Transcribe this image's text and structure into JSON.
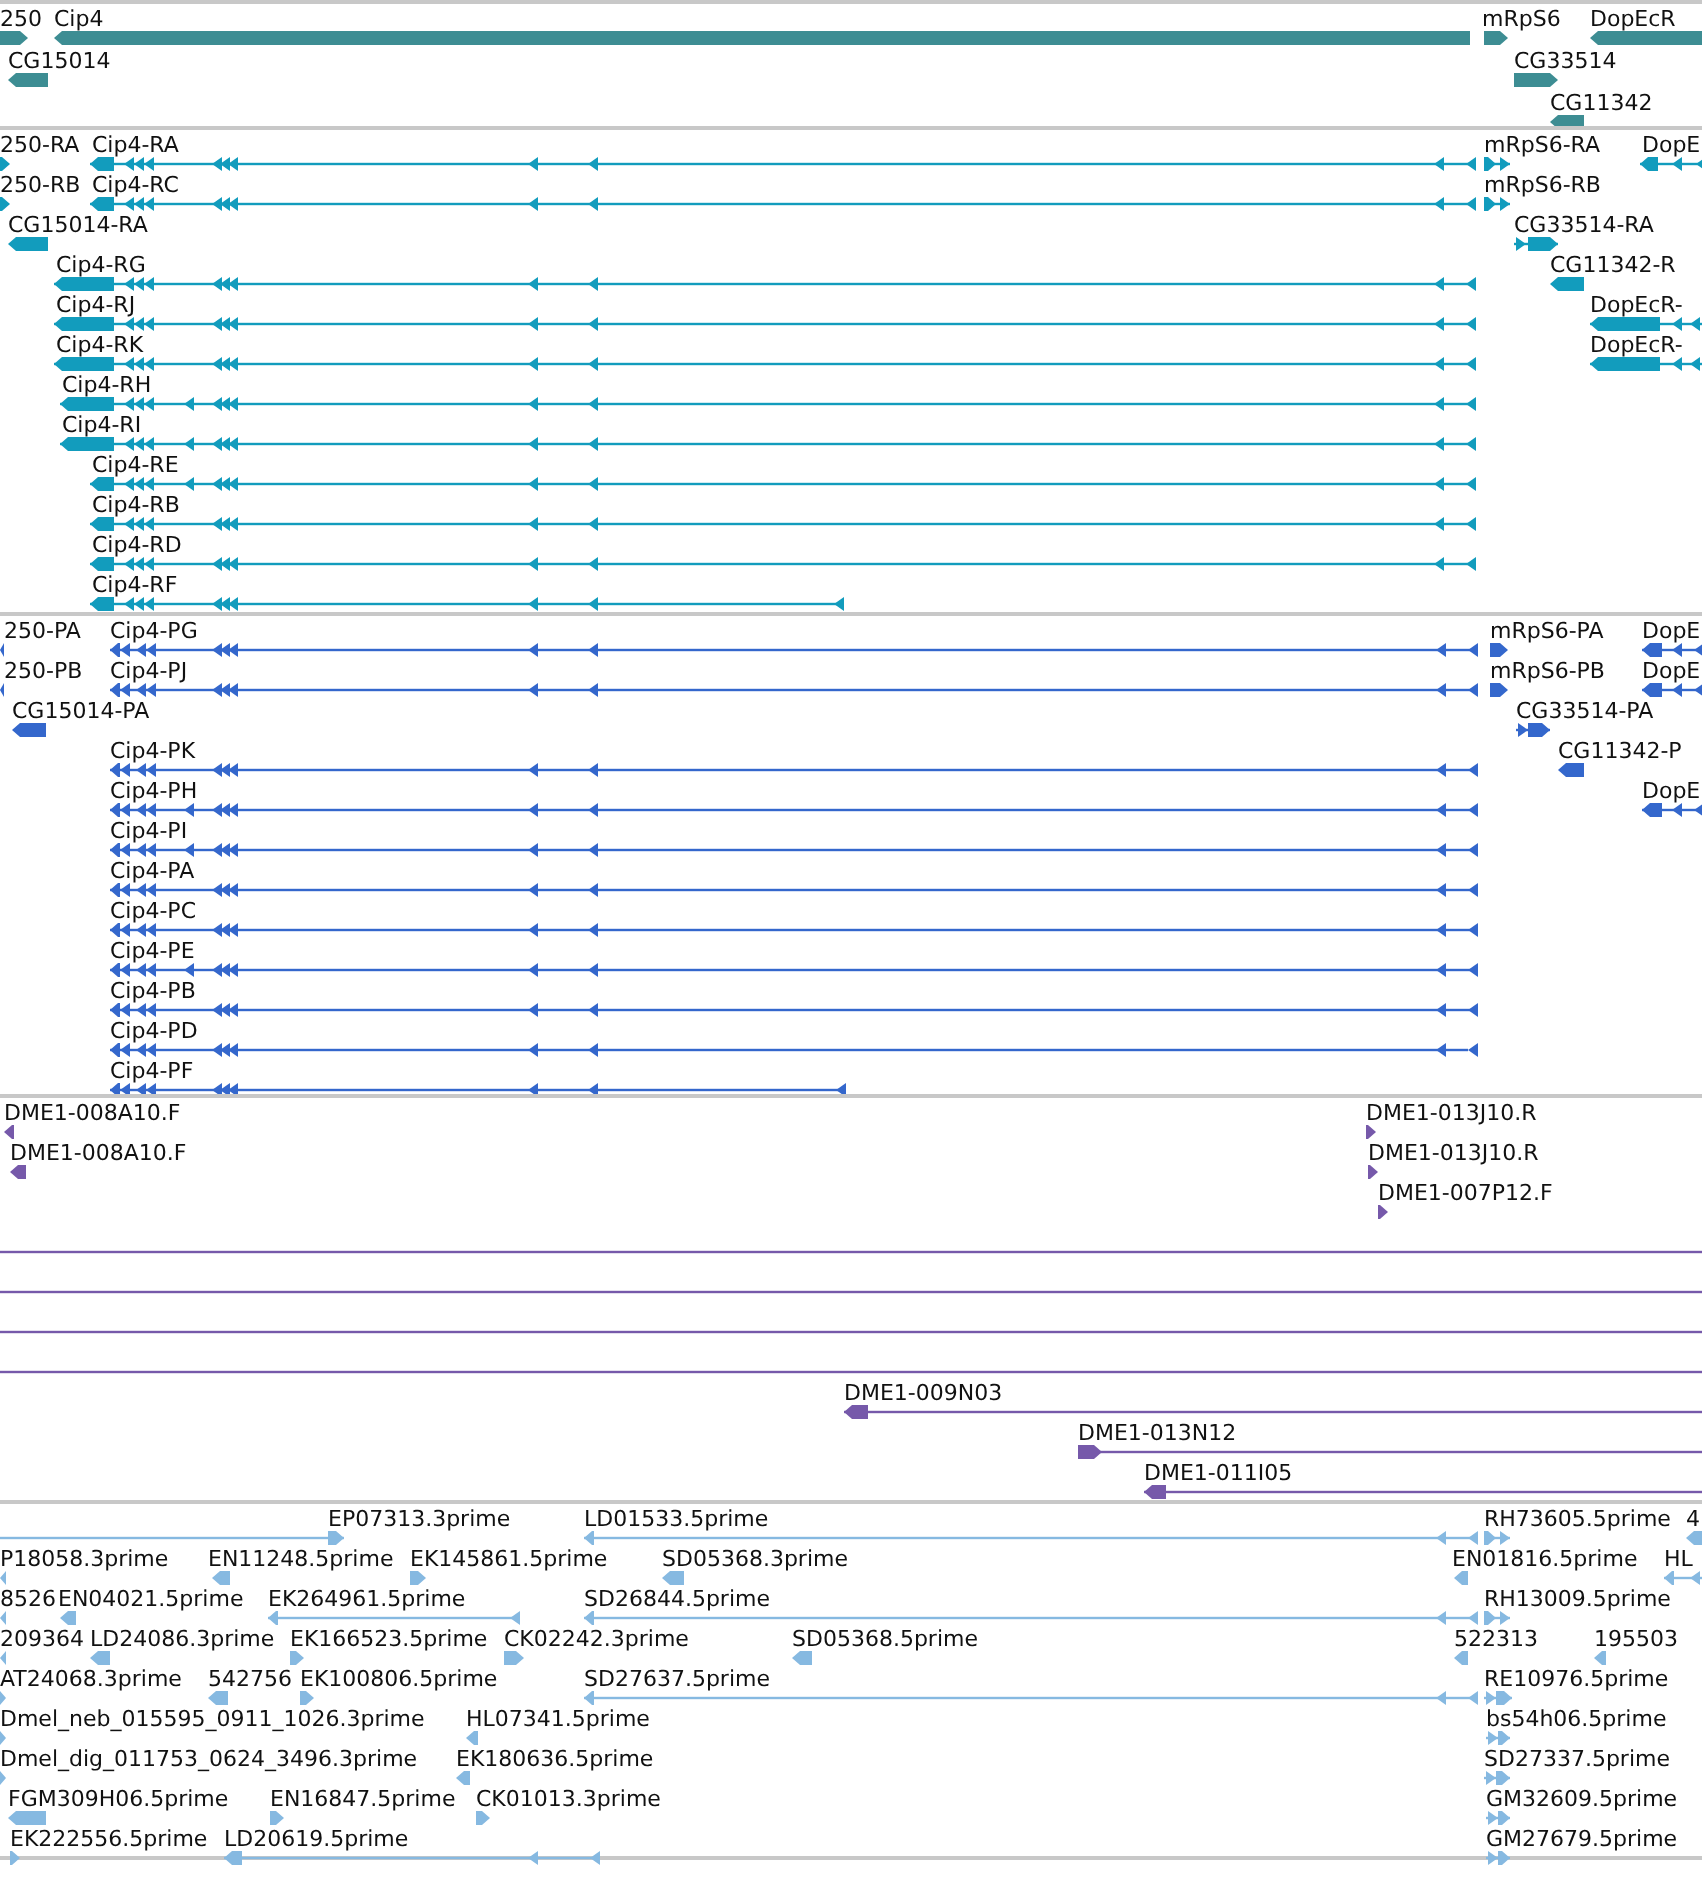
{
  "tracks": [
    {
      "kind": "gene",
      "features": [
        {
          "label": "250",
          "reverse": false
        },
        {
          "label": "Cip4",
          "reverse": true
        },
        {
          "label": "mRpS6",
          "reverse": false
        },
        {
          "label": "DopEcR",
          "reverse": true
        },
        {
          "label": "CG15014",
          "reverse": true
        },
        {
          "label": "CG33514",
          "reverse": false
        },
        {
          "label": "CG11342",
          "reverse": true
        }
      ]
    },
    {
      "kind": "mrna",
      "features": [
        {
          "label": "250-RA",
          "reverse": false
        },
        {
          "label": "Cip4-RA",
          "reverse": true
        },
        {
          "label": "mRpS6-RA",
          "reverse": false
        },
        {
          "label": "DopE",
          "reverse": true
        },
        {
          "label": "250-RB",
          "reverse": false
        },
        {
          "label": "Cip4-RC",
          "reverse": true
        },
        {
          "label": "mRpS6-RB",
          "reverse": false
        },
        {
          "label": "CG15014-RA",
          "reverse": true
        },
        {
          "label": "CG33514-RA",
          "reverse": false
        },
        {
          "label": "Cip4-RG",
          "reverse": true
        },
        {
          "label": "CG11342-R",
          "reverse": true
        },
        {
          "label": "Cip4-RJ",
          "reverse": true
        },
        {
          "label": "DopEcR-",
          "reverse": true
        },
        {
          "label": "Cip4-RK",
          "reverse": true
        },
        {
          "label": "DopEcR-",
          "reverse": true
        },
        {
          "label": "Cip4-RH",
          "reverse": true
        },
        {
          "label": "Cip4-RI",
          "reverse": true
        },
        {
          "label": "Cip4-RE",
          "reverse": true
        },
        {
          "label": "Cip4-RB",
          "reverse": true
        },
        {
          "label": "Cip4-RD",
          "reverse": true
        },
        {
          "label": "Cip4-RF",
          "reverse": true
        }
      ]
    },
    {
      "kind": "protein",
      "features": [
        {
          "label": "250-PA",
          "reverse": true
        },
        {
          "label": "Cip4-PG",
          "reverse": true
        },
        {
          "label": "mRpS6-PA",
          "reverse": false
        },
        {
          "label": "DopE",
          "reverse": true
        },
        {
          "label": "250-PB",
          "reverse": true
        },
        {
          "label": "Cip4-PJ",
          "reverse": true
        },
        {
          "label": "mRpS6-PB",
          "reverse": false
        },
        {
          "label": "DopE",
          "reverse": true
        },
        {
          "label": "CG15014-PA",
          "reverse": true
        },
        {
          "label": "CG33514-PA",
          "reverse": false
        },
        {
          "label": "Cip4-PK",
          "reverse": true
        },
        {
          "label": "CG11342-P",
          "reverse": true
        },
        {
          "label": "Cip4-PH",
          "reverse": true
        },
        {
          "label": "DopE",
          "reverse": true
        },
        {
          "label": "Cip4-PI",
          "reverse": true
        },
        {
          "label": "Cip4-PA",
          "reverse": true
        },
        {
          "label": "Cip4-PC",
          "reverse": true
        },
        {
          "label": "Cip4-PE",
          "reverse": true
        },
        {
          "label": "Cip4-PB",
          "reverse": true
        },
        {
          "label": "Cip4-PD",
          "reverse": true
        },
        {
          "label": "Cip4-PF",
          "reverse": true
        }
      ]
    },
    {
      "kind": "clone",
      "features": [
        {
          "label": "DME1-008A10.F",
          "reverse": true
        },
        {
          "label": "DME1-013J10.R",
          "reverse": false
        },
        {
          "label": "DME1-008A10.F",
          "reverse": true
        },
        {
          "label": "DME1-013J10.R",
          "reverse": false
        },
        {
          "label": "DME1-007P12.F",
          "reverse": false
        },
        {
          "kind": "span"
        },
        {
          "kind": "span"
        },
        {
          "kind": "span"
        },
        {
          "kind": "span"
        },
        {
          "label": "DME1-009N03",
          "reverse": true
        },
        {
          "label": "DME1-013N12",
          "reverse": false
        },
        {
          "label": "DME1-011I05",
          "reverse": true
        }
      ]
    },
    {
      "kind": "est",
      "features": [
        {
          "label": "EP07313.3prime",
          "reverse": false
        },
        {
          "label": "LD01533.5prime",
          "reverse": true
        },
        {
          "label": "RH73605.5prime",
          "reverse": false
        },
        {
          "label": "4",
          "reverse": true
        },
        {
          "label": "P18058.3prime",
          "reverse": true
        },
        {
          "label": "EN11248.5prime",
          "reverse": true
        },
        {
          "label": "EK145861.5prime",
          "reverse": false
        },
        {
          "label": "SD05368.3prime",
          "reverse": true
        },
        {
          "label": "EN01816.5prime",
          "reverse": true
        },
        {
          "label": "HL",
          "reverse": true
        },
        {
          "label": "8526",
          "reverse": true
        },
        {
          "label": "EN04021.5prime",
          "reverse": true
        },
        {
          "label": "EK264961.5prime",
          "reverse": true
        },
        {
          "label": "SD26844.5prime",
          "reverse": true
        },
        {
          "label": "RH13009.5prime",
          "reverse": false
        },
        {
          "label": "209364",
          "reverse": true
        },
        {
          "label": "LD24086.3prime",
          "reverse": true
        },
        {
          "label": "EK166523.5prime",
          "reverse": false
        },
        {
          "label": "CK02242.3prime",
          "reverse": false
        },
        {
          "label": "SD05368.5prime",
          "reverse": true
        },
        {
          "label": "522313",
          "reverse": true
        },
        {
          "label": "195503",
          "reverse": true
        },
        {
          "label": "AT24068.3prime",
          "reverse": false
        },
        {
          "label": "542756",
          "reverse": true
        },
        {
          "label": "EK100806.5prime",
          "reverse": false
        },
        {
          "label": "SD27637.5prime",
          "reverse": true
        },
        {
          "label": "RE10976.5prime",
          "reverse": false
        },
        {
          "label": "Dmel_neb_015595_0911_1026.3prime",
          "reverse": false
        },
        {
          "label": "HL07341.5prime",
          "reverse": true
        },
        {
          "label": "bs54h06.5prime",
          "reverse": false
        },
        {
          "label": "Dmel_dig_011753_0624_3496.3prime",
          "reverse": false
        },
        {
          "label": "EK180636.5prime",
          "reverse": true
        },
        {
          "label": "SD27337.5prime",
          "reverse": false
        },
        {
          "label": "FGM309H06.5prime",
          "reverse": true
        },
        {
          "label": "EN16847.5prime",
          "reverse": false
        },
        {
          "label": "CK01013.3prime",
          "reverse": false
        },
        {
          "label": "GM32609.5prime",
          "reverse": false
        },
        {
          "label": "EK222556.5prime",
          "reverse": false
        },
        {
          "label": "LD20619.5prime",
          "reverse": true
        },
        {
          "label": "GM27679.5prime",
          "reverse": false
        }
      ]
    }
  ]
}
